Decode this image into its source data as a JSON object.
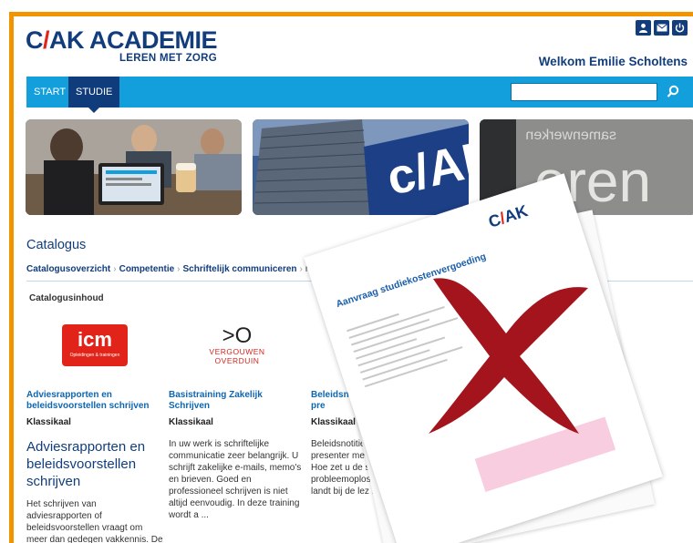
{
  "logo": {
    "main_a": "C",
    "main_slash": "/",
    "main_b": "AK ACADEMIE",
    "tagline": "LEREN MET ZORG"
  },
  "header": {
    "welcome": "Welkom Emilie Scholtens",
    "icons": [
      "user-icon",
      "mail-icon",
      "power-icon"
    ]
  },
  "nav": {
    "items": [
      "START",
      "STUDIE"
    ],
    "active": "STUDIE"
  },
  "search": {
    "placeholder": "",
    "value": ""
  },
  "catalog": {
    "heading": "Catalogus",
    "breadcrumb": [
      "Catalogusoverzicht",
      "Competentie",
      "Schriftelijk communiceren",
      "niveau"
    ],
    "content_title": "Catalogusinhoud"
  },
  "courses": [
    {
      "logo_text": "icm",
      "logo_sub": "Opleidingen & trainingen",
      "title": "Adviesrapporten en beleidsvoorstellen schrijven",
      "type": "Klassikaal",
      "big_title": "Adviesrapporten en beleidsvoorstellen schrijven",
      "description": "Het schrijven van adviesrapporten of beleidsvoorstellen vraagt om meer dan gedegen vakkennis. De inhoud samen met de verpakking bepa ..."
    },
    {
      "logo_symbol": ">O",
      "logo_line1": "VERGOUWEN",
      "logo_line2": "OVERDUIN",
      "title": "Basistraining Zakelijk Schrijven",
      "type": "Klassikaal",
      "description": "In uw werk is schriftelijke communicatie zeer belangrijk. U schrijft zakelijke e-mails, memo's en brieven. Goed en professioneel schrijven is niet altijd eenvoudig. In deze training wordt a ..."
    },
    {
      "title": "Beleidsnotities schrijven en pre",
      "type": "Klassikaal",
      "description": "Beleidsnotities en ad schrijven en presenter mensen lastig. Hoe pa Hoe zet u de stap van de probleemoplossing naar e die landt bij de lez ..."
    }
  ],
  "overlay_form": {
    "title": "Aanvraag studiekostenvergoeding",
    "logo": "C/AK"
  },
  "colors": {
    "brand_navy": "#123d7c",
    "nav_blue": "#139fdc",
    "frame_orange": "#f29400",
    "x_red": "#a3141c"
  }
}
